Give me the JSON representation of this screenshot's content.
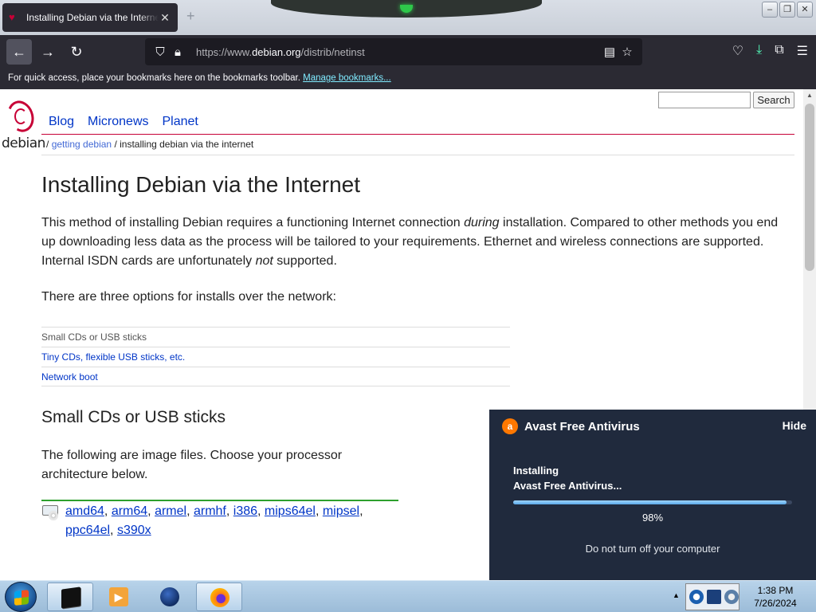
{
  "browser": {
    "tab_title": "Installing Debian via the Internet",
    "tab_close": "✕",
    "new_tab": "+",
    "url_prefix": "https://www.",
    "url_domain": "debian.org",
    "url_path": "/distrib/netinst",
    "bookmarks_hint": "For quick access, place your bookmarks here on the bookmarks toolbar.",
    "bookmarks_link": "Manage bookmarks..."
  },
  "site": {
    "logo_text": "debian",
    "nav": [
      "Blog",
      "Micronews",
      "Planet"
    ],
    "search_button": "Search",
    "search_value": "",
    "breadcrumb": {
      "sep": "/",
      "link": "getting debian",
      "current": "/ installing debian via the internet"
    }
  },
  "content": {
    "title": "Installing Debian via the Internet",
    "intro_1": "This method of installing Debian requires a functioning Internet connection ",
    "intro_em1": "during",
    "intro_2": " installation. Compared to other methods you end up downloading less data as the process will be tailored to your requirements. Ethernet and wireless connections are supported. Internal ISDN cards are unfortunately ",
    "intro_em2": "not",
    "intro_3": " supported.",
    "options_intro": "There are three options for installs over the network:",
    "toc": [
      "Small CDs or USB sticks",
      "Tiny CDs, flexible USB sticks, etc.",
      "Network boot"
    ],
    "section_title": "Small CDs or USB sticks",
    "section_text": "The following are image files. Choose your processor architecture below.",
    "architectures": [
      "amd64",
      "arm64",
      "armel",
      "armhf",
      "i386",
      "mips64el",
      "mipsel",
      "ppc64el",
      "s390x"
    ]
  },
  "avast": {
    "title": "Avast Free Antivirus",
    "hide": "Hide",
    "installing_line1": "Installing",
    "installing_line2": "Avast Free Antivirus...",
    "progress": 0.98,
    "progress_label": "98%",
    "warning": "Do not turn off your computer"
  },
  "taskbar": {
    "time": "1:38 PM",
    "date": "7/26/2024"
  },
  "colors": {
    "debian_red": "#c70036",
    "link_blue": "#0035c7",
    "avast_bg": "#202a3d",
    "avast_orange": "#ff7800"
  }
}
